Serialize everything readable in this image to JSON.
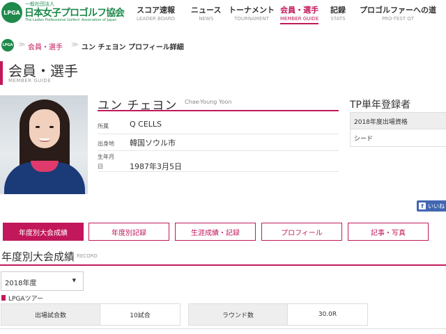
{
  "header": {
    "logo_mark": "LPGA",
    "logo_small": "一般社団法人",
    "logo_main": "日本女子プロゴルフ協会",
    "logo_sub": "The Ladies Professional Golfers' Association of Japan",
    "nav": [
      {
        "label": "スコア速報",
        "sub": "LEADER BOARD"
      },
      {
        "label": "ニュース",
        "sub": "NEWS"
      },
      {
        "label": "トーナメント",
        "sub": "TOURNAMENT"
      },
      {
        "label": "会員・選手",
        "sub": "MEMBER GUIDE"
      },
      {
        "label": "記録",
        "sub": "STATS"
      },
      {
        "label": "プロゴルファーへの道",
        "sub": "PRO-TEST QT"
      }
    ]
  },
  "breadcrumb": {
    "logo": "LPGA",
    "sep": "≫",
    "parent": "会員・選手",
    "current": "ユン チェヨン プロフィール詳細"
  },
  "page": {
    "title": "会員・選手",
    "title_en": "MEMBER GUIDE"
  },
  "profile": {
    "name_jp": "ユン チェヨン",
    "name_en": "Chae-Young Yoon",
    "rows": [
      {
        "label": "所属",
        "value": "Q CELLS"
      },
      {
        "label": "出身地",
        "value": "韓国ソウル市"
      },
      {
        "label": "生年月日",
        "value": "1987年3月5日"
      }
    ]
  },
  "registration": {
    "title": "TP単年登録者",
    "head": "2018年度出場資格",
    "value": "シード"
  },
  "social": {
    "like_icon": "f",
    "like_label": "いいね"
  },
  "tabs": [
    "年度別大会成績",
    "年度別記録",
    "生涯成績・記録",
    "プロフィール",
    "記事・写真"
  ],
  "record": {
    "title": "年度別大会成績",
    "title_en": "RECORD",
    "year_selected": "2018年度",
    "tour": "LPGAツアー",
    "stats": [
      {
        "label": "出場試合数",
        "value": "10試合"
      },
      {
        "label": "ラウンド数",
        "value": "30.0R"
      }
    ]
  },
  "colors": {
    "accent": "#c2185b",
    "brand": "#1f8a4c",
    "facebook": "#4267b2"
  }
}
